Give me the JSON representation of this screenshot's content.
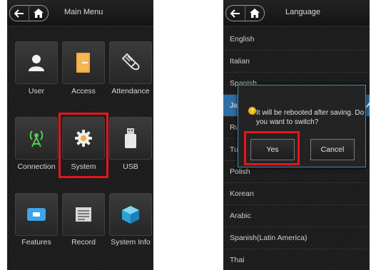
{
  "left_screen": {
    "title": "Main Menu",
    "items": [
      {
        "label": "User",
        "icon": "user-icon"
      },
      {
        "label": "Access",
        "icon": "door-icon"
      },
      {
        "label": "Attendance",
        "icon": "attendance-icon"
      },
      {
        "label": "Connection",
        "icon": "antenna-icon"
      },
      {
        "label": "System",
        "icon": "gear-icon"
      },
      {
        "label": "USB",
        "icon": "usb-drive-icon"
      },
      {
        "label": "Features",
        "icon": "card-icon"
      },
      {
        "label": "Record",
        "icon": "record-icon"
      },
      {
        "label": "System Info",
        "icon": "cube-icon"
      }
    ],
    "highlighted_item": "System"
  },
  "right_screen": {
    "title": "Language",
    "languages": [
      "English",
      "Italian",
      "Spanish",
      "Japanese",
      "Russian",
      "Turkish",
      "Polish",
      "Korean",
      "Arabic",
      "Spanish(Latin America)",
      "Thai"
    ],
    "visible_language_text": [
      "English",
      "Italian",
      "Spanish",
      "Ja",
      "Ru",
      "Tu",
      "Polish",
      "Korean",
      "Arabic",
      "Spanish(Latin America)",
      "Thai"
    ],
    "selected_index": 3,
    "dialog": {
      "message": "It will be rebooted after saving. Do you want to switch?",
      "yes_label": "Yes",
      "cancel_label": "Cancel",
      "highlighted_button": "Yes"
    }
  },
  "colors": {
    "highlight": "#e8141c",
    "selected_row": "#2d6fa6",
    "dialog_border": "#3a8fb6",
    "info_icon": "#f0b400"
  }
}
